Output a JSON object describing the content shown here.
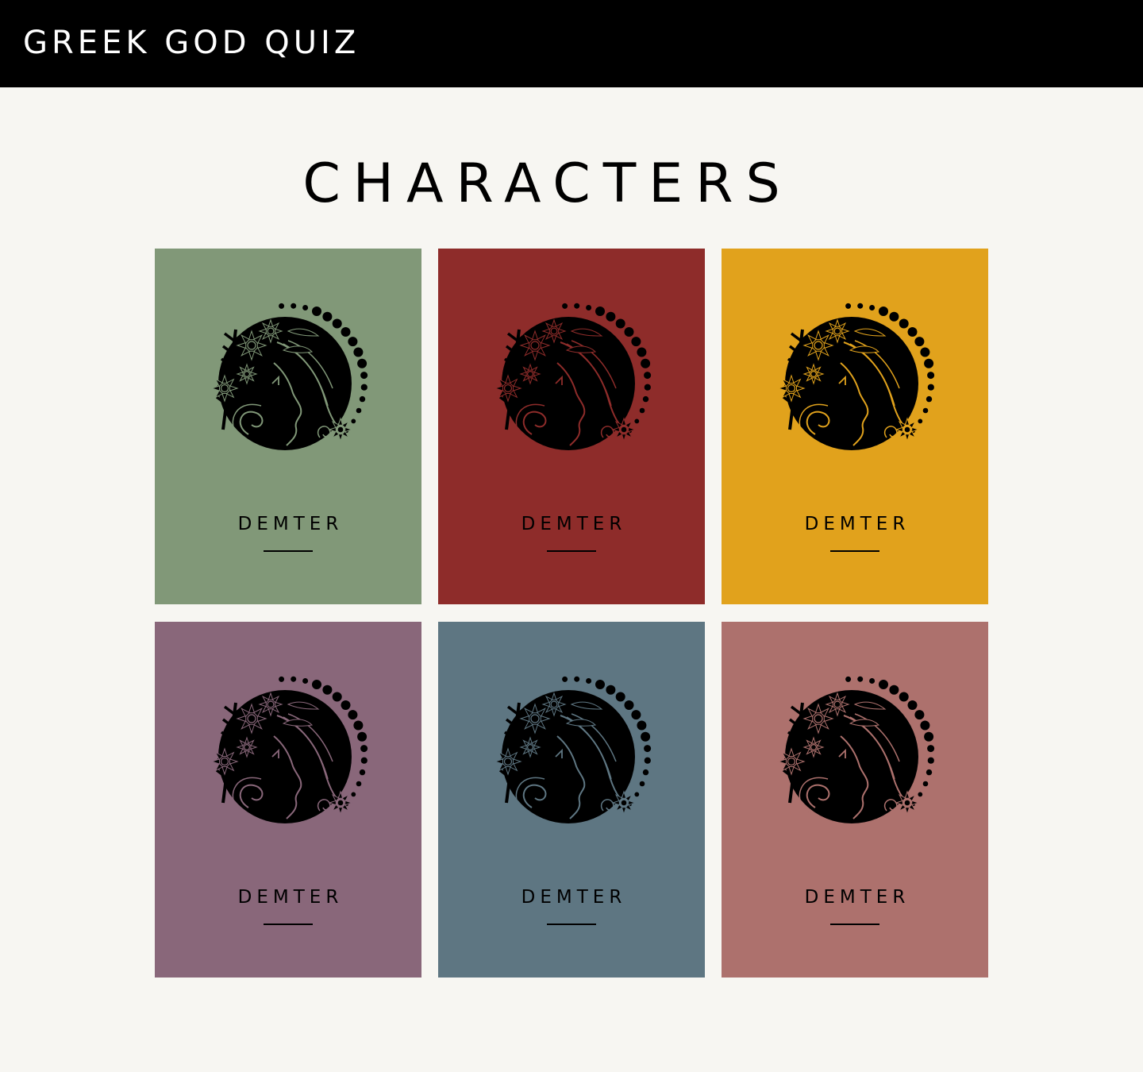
{
  "header": {
    "site_title": "GREEK GOD QUIZ"
  },
  "main": {
    "title": "CHARACTERS",
    "cards": [
      {
        "name": "DEMTER",
        "color": "#819878"
      },
      {
        "name": "DEMTER",
        "color": "#8e2c2a"
      },
      {
        "name": "DEMTER",
        "color": "#e1a21c"
      },
      {
        "name": "DEMTER",
        "color": "#89677a"
      },
      {
        "name": "DEMTER",
        "color": "#5e7682"
      },
      {
        "name": "DEMTER",
        "color": "#ad716d"
      }
    ]
  },
  "icons": {
    "card_emblem": "demeter-emblem-icon"
  }
}
